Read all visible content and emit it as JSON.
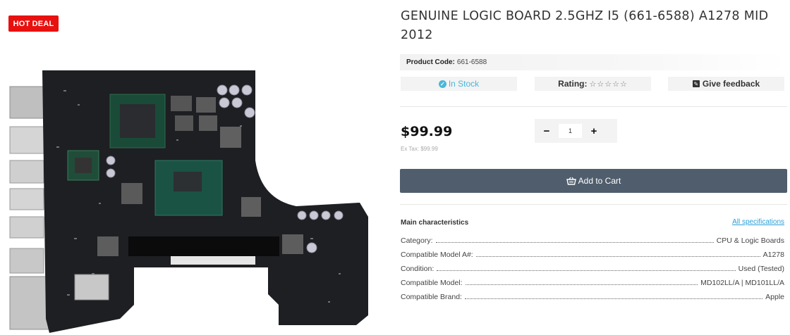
{
  "badge": {
    "label": "HOT DEAL",
    "color": "#e8110f"
  },
  "product": {
    "title": "GENUINE LOGIC BOARD 2.5GHZ I5 (661-6588) A1278 MID 2012",
    "code_label": "Product Code:",
    "code_value": "661-6588",
    "stock_label": "In Stock",
    "rating_label": "Rating:",
    "rating_stars": "☆☆☆☆☆",
    "feedback_label": "Give feedback",
    "price": "$99.99",
    "extax_label": "Ex Tax:",
    "extax_value": "$99.99",
    "qty_minus": "−",
    "qty_value": "1",
    "qty_plus": "+",
    "add_to_cart": "Add to Cart"
  },
  "characteristics": {
    "heading": "Main characteristics",
    "all_specs_link": "All specifications",
    "rows": [
      {
        "key": "Category:",
        "value": "CPU & Logic Boards"
      },
      {
        "key": "Compatible Model A#:",
        "value": "A1278"
      },
      {
        "key": "Condition:",
        "value": "Used (Tested)"
      },
      {
        "key": "Compatible Model:",
        "value": "MD102LL/A | MD101LL/A"
      },
      {
        "key": "Compatible Brand:",
        "value": "Apple"
      }
    ]
  },
  "colors": {
    "accent": "#4ab6d8",
    "cart_button": "#4f5d6c",
    "link": "#2aa0d8"
  },
  "icons": {
    "stock": "check-circle-icon",
    "feedback": "pencil-icon",
    "cart": "basket-icon"
  }
}
